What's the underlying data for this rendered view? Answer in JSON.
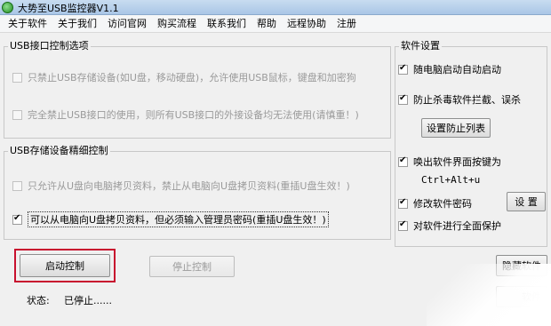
{
  "window": {
    "title": "大势至USB监控器V1.1"
  },
  "menu": [
    "关于软件",
    "关于我们",
    "访问官网",
    "购买流程",
    "联系我们",
    "帮助",
    "远程协助",
    "注册"
  ],
  "usb_port_group": {
    "legend": "USB接口控制选项",
    "options": [
      {
        "label": "只禁止USB存储设备(如U盘，移动硬盘)，允许使用USB鼠标，键盘和加密狗",
        "checked": false,
        "enabled": false
      },
      {
        "label": "完全禁止USB接口的使用，则所有USB接口的外接设备均无法使用(请慎重！)",
        "checked": false,
        "enabled": false
      }
    ]
  },
  "usb_storage_group": {
    "legend": "USB存储设备精细控制",
    "options": [
      {
        "label": "只允许从U盘向电脑拷贝资料，禁止从电脑向U盘拷贝资料(重插U盘生效！)",
        "checked": false,
        "enabled": false
      },
      {
        "label": "可以从电脑向U盘拷贝资料，但必须输入管理员密码(重插U盘生效！)",
        "checked": true,
        "enabled": true
      }
    ]
  },
  "software_settings": {
    "legend": "软件设置",
    "autostart_label": "随电脑启动自动启动",
    "antivirus_label": "防止杀毒软件拦截、误杀",
    "prevent_list_button": "设置防止列表",
    "hotkey_label": "唤出软件界面按键为",
    "hotkey_value": "Ctrl+Alt+u",
    "password_label": "修改软件密码",
    "password_set_button": "设 置",
    "protect_label": "对软件进行全面保护"
  },
  "controls": {
    "start_button": "启动控制",
    "stop_button": "停止控制",
    "hide_button": "隐藏软件",
    "exit_button_fragment": "软件"
  },
  "status": {
    "label": "状态:",
    "value": "已停止......"
  },
  "colors": {
    "highlight": "#c8102e",
    "window_bg": "#f0f0f0"
  }
}
